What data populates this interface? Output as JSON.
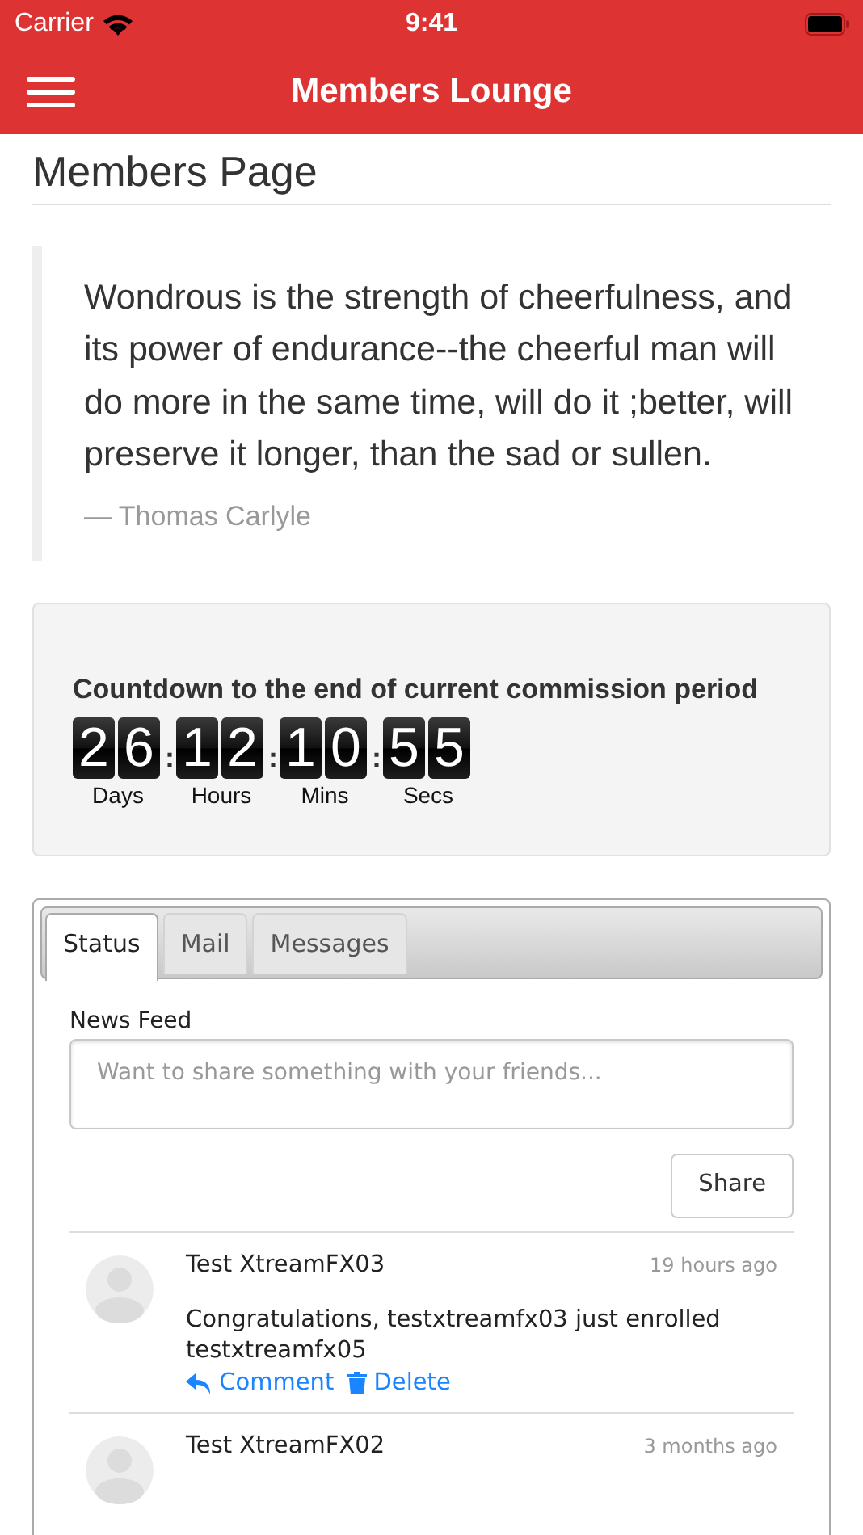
{
  "status_bar": {
    "carrier": "Carrier",
    "time": "9:41"
  },
  "navbar": {
    "title": "Members Lounge"
  },
  "page_title": "Members Page",
  "quote": {
    "text": "Wondrous is the strength of cheerfulness, and its power of endurance--the cheerful man will do more in the same time, will do it ;better, will preserve it longer, than the sad or sullen.",
    "author": "— Thomas Carlyle"
  },
  "countdown": {
    "title": "Countdown to the end of current commission period",
    "separator": ":",
    "units": [
      {
        "digits": [
          "2",
          "6"
        ],
        "label": "Days"
      },
      {
        "digits": [
          "1",
          "2"
        ],
        "label": "Hours"
      },
      {
        "digits": [
          "1",
          "0"
        ],
        "label": "Mins"
      },
      {
        "digits": [
          "5",
          "5"
        ],
        "label": "Secs"
      }
    ]
  },
  "tabs": [
    {
      "label": "Status",
      "selected": true
    },
    {
      "label": "Mail",
      "selected": false
    },
    {
      "label": "Messages",
      "selected": false
    }
  ],
  "news_feed": {
    "label": "News Feed",
    "placeholder": "Want to share something with your friends...",
    "share_button": "Share",
    "posts": [
      {
        "name": "Test XtreamFX03",
        "time": "19 hours ago",
        "text": "Congratulations, testxtreamfx03 just enrolled testxtreamfx05",
        "actions": [
          "Comment",
          "Delete"
        ]
      },
      {
        "name": "Test XtreamFX02",
        "time": "3 months ago"
      }
    ]
  }
}
